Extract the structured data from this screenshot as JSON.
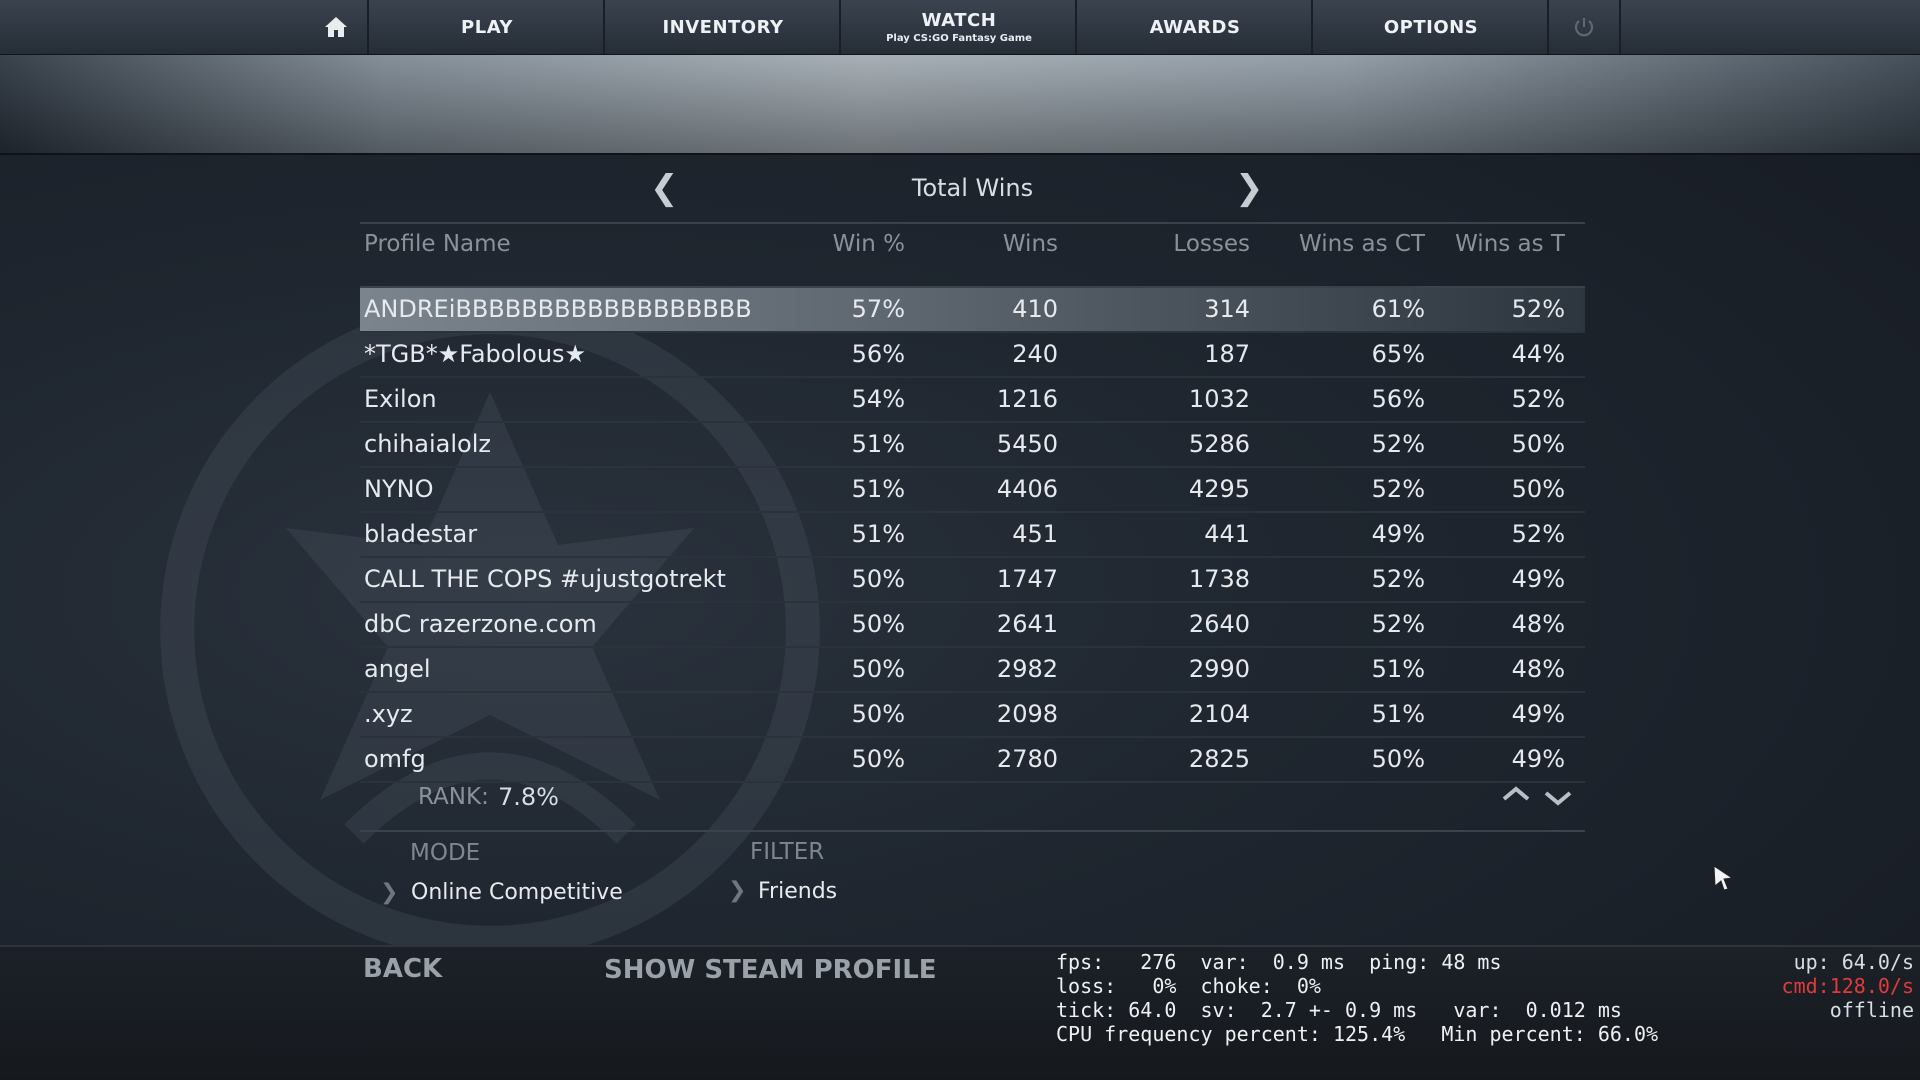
{
  "nav": {
    "play": "PLAY",
    "inventory": "INVENTORY",
    "watch": "WATCH",
    "watch_sub": "Play CS:GO Fantasy Game",
    "awards": "AWARDS",
    "options": "OPTIONS"
  },
  "leaderboard": {
    "title": "Total Wins",
    "prev_glyph": "❮",
    "next_glyph": "❯",
    "columns": [
      "Profile Name",
      "Win %",
      "Wins",
      "Losses",
      "Wins as CT",
      "Wins as T"
    ],
    "rows": [
      {
        "name": "ANDREiBBBBBBBBBBBBBBBBBBBBBBBB",
        "win_pct": "57%",
        "wins": "410",
        "losses": "314",
        "wins_ct": "61%",
        "wins_t": "52%"
      },
      {
        "name": "*TGB*★Fabolous★",
        "win_pct": "56%",
        "wins": "240",
        "losses": "187",
        "wins_ct": "65%",
        "wins_t": "44%"
      },
      {
        "name": "Exilon",
        "win_pct": "54%",
        "wins": "1216",
        "losses": "1032",
        "wins_ct": "56%",
        "wins_t": "52%"
      },
      {
        "name": "chihaialolz",
        "win_pct": "51%",
        "wins": "5450",
        "losses": "5286",
        "wins_ct": "52%",
        "wins_t": "50%"
      },
      {
        "name": "NYNO",
        "win_pct": "51%",
        "wins": "4406",
        "losses": "4295",
        "wins_ct": "52%",
        "wins_t": "50%"
      },
      {
        "name": "bladestar",
        "win_pct": "51%",
        "wins": "451",
        "losses": "441",
        "wins_ct": "49%",
        "wins_t": "52%"
      },
      {
        "name": "CALL THE COPS #ujustgotrekt",
        "win_pct": "50%",
        "wins": "1747",
        "losses": "1738",
        "wins_ct": "52%",
        "wins_t": "49%"
      },
      {
        "name": "dbC razerzone.com",
        "win_pct": "50%",
        "wins": "2641",
        "losses": "2640",
        "wins_ct": "52%",
        "wins_t": "48%"
      },
      {
        "name": "angel",
        "win_pct": "50%",
        "wins": "2982",
        "losses": "2990",
        "wins_ct": "51%",
        "wins_t": "48%"
      },
      {
        "name": ".xyz",
        "win_pct": "50%",
        "wins": "2098",
        "losses": "2104",
        "wins_ct": "51%",
        "wins_t": "49%"
      },
      {
        "name": "omfg",
        "win_pct": "50%",
        "wins": "2780",
        "losses": "2825",
        "wins_ct": "50%",
        "wins_t": "49%"
      }
    ],
    "selected_row": 0
  },
  "rank": {
    "label": "RANK:",
    "value": "7.8%"
  },
  "mode": {
    "label": "MODE",
    "value": "Online Competitive",
    "chevron": "❯"
  },
  "filter": {
    "label": "FILTER",
    "value": "Friends",
    "chevron": "❯"
  },
  "bottom": {
    "back": "BACK",
    "steam_profile": "SHOW STEAM PROFILE"
  },
  "netgraph": {
    "line1": "fps:   276  var:  0.9 ms  ping: 48 ms",
    "line2": "loss:   0%  choke:  0%",
    "line3": "tick: 64.0  sv:  2.7 +- 0.9 ms   var:  0.012 ms",
    "line4": "CPU frequency percent: 125.4%   Min percent: 66.0%",
    "up": "up: 64.0/s",
    "cmd": "cmd:128.0/s",
    "status": "offline"
  },
  "icons": {
    "home": "home-icon",
    "power": "power-icon",
    "scroll_up": "chevron-up-icon",
    "scroll_down": "chevron-down-icon",
    "cursor": "mouse-cursor-icon"
  },
  "colors": {
    "netgraph_cmd": "#e03a3a",
    "selected_row": "#6f7880"
  }
}
